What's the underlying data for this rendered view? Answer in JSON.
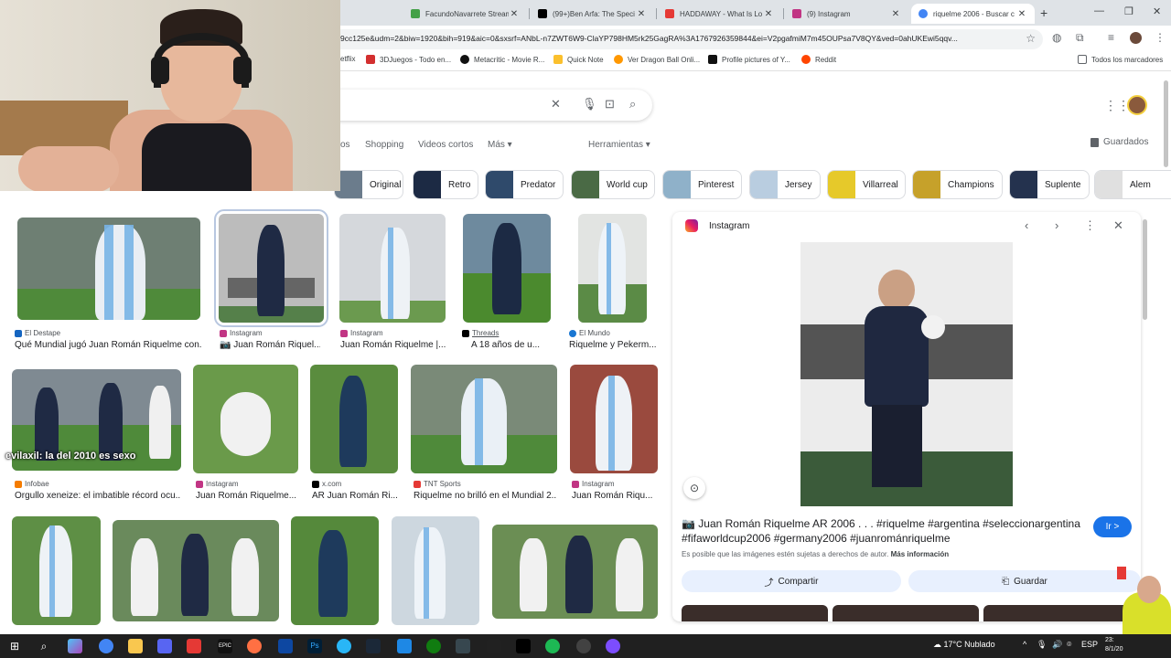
{
  "browser": {
    "tabs": [
      {
        "title": "FacundoNavarrete Stream",
        "color": "#43a047"
      },
      {
        "title": "(99+)Ben Arfa: The Speci",
        "color": "#000000"
      },
      {
        "title": "HADDAWAY - What Is Lo",
        "color": "#e53935"
      },
      {
        "title": "(9) Instagram",
        "color": "#c13584"
      },
      {
        "title": "riquelme 2006 - Buscar c",
        "color": "#4285f4"
      }
    ],
    "url": "9cc125e&udm=2&biw=1920&bih=919&aic=0&sxsrf=ANbL-n7ZWT6W9-ClaYP798HM5rk25GagRA%3A1767926359844&ei=V2pgafmiM7m45OUPsa7V8QY&ved=0ahUKEwi5qqv...",
    "bookmarks": [
      {
        "label": "etflix",
        "color": "#e50914"
      },
      {
        "label": "3DJuegos - Todo en...",
        "color": "#d32f2f"
      },
      {
        "label": "Metacritic - Movie R...",
        "color": "#000000"
      },
      {
        "label": "Quick Note",
        "color": "#fbc02d"
      },
      {
        "label": "Ver Dragon Ball Onli...",
        "color": "#ff9800"
      },
      {
        "label": "Profile pictures of Y...",
        "color": "#000000"
      },
      {
        "label": "Reddit",
        "color": "#ff4500"
      }
    ],
    "all_bookmarks": "Todos los marcadores"
  },
  "google": {
    "tabs": [
      "os",
      "Shopping",
      "Videos cortos",
      "Más ▾",
      "Herramientas ▾"
    ],
    "saved": "Guardados",
    "chips": [
      "Original",
      "Retro",
      "Predator",
      "World cup",
      "Pinterest",
      "Jersey",
      "Villarreal",
      "Champions",
      "Suplente",
      "Alem"
    ]
  },
  "results": {
    "row1": [
      {
        "source": "El Destape",
        "caption": "Qué Mundial jugó Juan Román Riquelme con...",
        "src_color": "#1565c0"
      },
      {
        "source": "Instagram",
        "caption": "📷 Juan Román Riquel...",
        "src_color": "#c13584"
      },
      {
        "source": "Instagram",
        "caption": "Juan Román Riquelme |...",
        "src_color": "#c13584"
      },
      {
        "source": "Threads",
        "caption": "A 18 años de u...",
        "src_color": "#000000"
      },
      {
        "source": "El Mundo",
        "caption": "Riquelme y Pekerm...",
        "src_color": "#1976d2"
      }
    ],
    "row2": [
      {
        "source": "Infobae",
        "caption": "Orgullo xeneize: el imbatible récord ocu...",
        "src_color": "#f57c00"
      },
      {
        "source": "Instagram",
        "caption": "Juan Román Riquelme...",
        "src_color": "#c13584"
      },
      {
        "source": "x.com",
        "caption": "AR Juan Román Ri...",
        "src_color": "#000000"
      },
      {
        "source": "TNT Sports",
        "caption": "Riquelme no brilló en el Mundial 2...",
        "src_color": "#e53935"
      },
      {
        "source": "Instagram",
        "caption": "Juan Román Riqu...",
        "src_color": "#c13584"
      }
    ],
    "overlay_text": "evilaxil: la del 2010 es sexo"
  },
  "panel": {
    "source": "Instagram",
    "title": "📷 Juan Román Riquelme AR 2006 . . . #riquelme #argentina #seleccionargentina #fifaworldcup2006 #germany2006 #juanrománriquelme",
    "visit": "Ir >",
    "copyright": "Es posible que las imágenes estén sujetas a derechos de autor.",
    "more_info": "Más información",
    "share": "Compartir",
    "save": "Guardar"
  },
  "taskbar": {
    "weather": "17°C  Nublado",
    "lang": "ESP",
    "time": "23:",
    "date": "8/1/20"
  }
}
